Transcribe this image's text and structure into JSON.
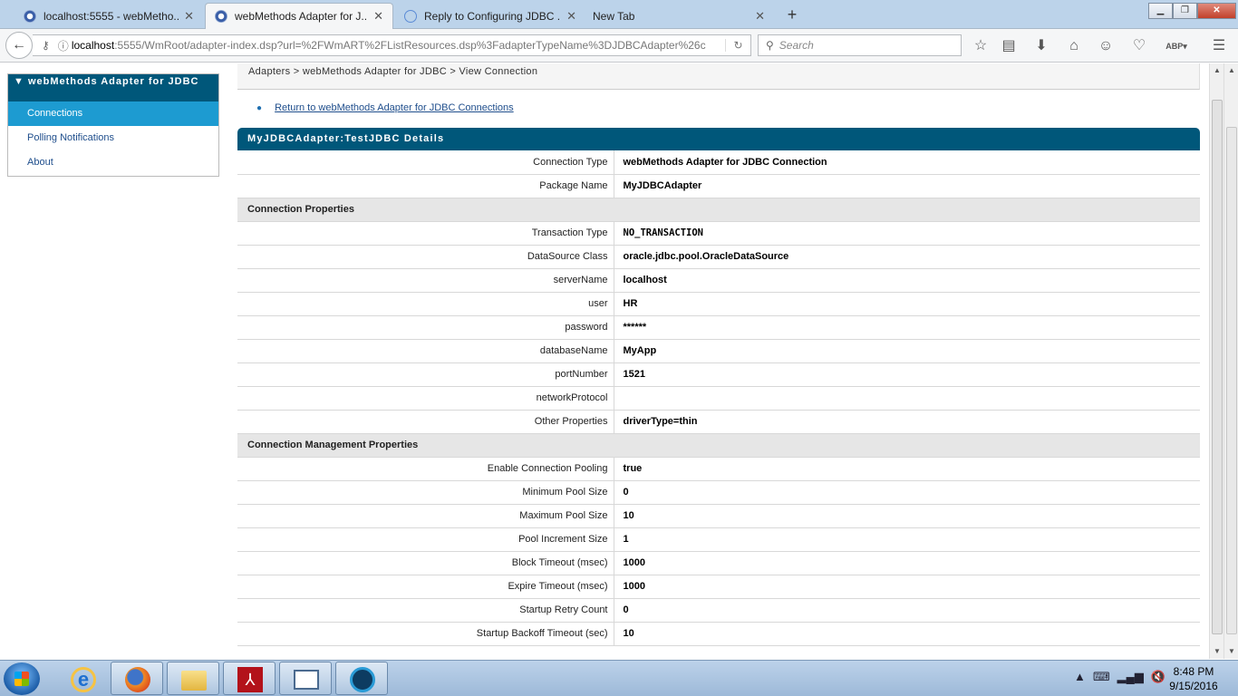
{
  "browser": {
    "tabs": [
      {
        "label": "localhost:5555 - webMetho..."
      },
      {
        "label": "webMethods Adapter for J..."
      },
      {
        "label": "Reply to Configuring JDBC ..."
      },
      {
        "label": "New Tab"
      }
    ],
    "url_host": "localhost",
    "url_rest": ":5555/WmRoot/adapter-index.dsp?url=%2FWmART%2FListResources.dsp%3FadapterTypeName%3DJDBCAdapter%26c",
    "search_placeholder": "Search",
    "abp_label": "ABP"
  },
  "sidebar": {
    "title": "webMethods Adapter for JDBC",
    "items": [
      {
        "label": "Connections"
      },
      {
        "label": "Polling Notifications"
      },
      {
        "label": "About"
      }
    ]
  },
  "breadcrumb": "Adapters > webMethods Adapter for JDBC > View Connection",
  "return_link": "Return to webMethods Adapter for JDBC Connections",
  "details": {
    "title": "MyJDBCAdapter:TestJDBC Details",
    "rows": [
      {
        "label": "Connection Type",
        "value": "webMethods Adapter for JDBC Connection"
      },
      {
        "label": "Package Name",
        "value": "MyJDBCAdapter"
      }
    ],
    "section1": "Connection Properties",
    "conn_props": [
      {
        "label": "Transaction Type",
        "value": "NO_TRANSACTION"
      },
      {
        "label": "DataSource Class",
        "value": "oracle.jdbc.pool.OracleDataSource"
      },
      {
        "label": "serverName",
        "value": "localhost"
      },
      {
        "label": "user",
        "value": "HR"
      },
      {
        "label": "password",
        "value": "******"
      },
      {
        "label": "databaseName",
        "value": "MyApp"
      },
      {
        "label": "portNumber",
        "value": "1521"
      },
      {
        "label": "networkProtocol",
        "value": ""
      },
      {
        "label": "Other Properties",
        "value": "driverType=thin"
      }
    ],
    "section2": "Connection Management Properties",
    "mgmt_props": [
      {
        "label": "Enable Connection Pooling",
        "value": "true"
      },
      {
        "label": "Minimum Pool Size",
        "value": "0"
      },
      {
        "label": "Maximum Pool Size",
        "value": "10"
      },
      {
        "label": "Pool Increment Size",
        "value": "1"
      },
      {
        "label": "Block Timeout (msec)",
        "value": "1000"
      },
      {
        "label": "Expire Timeout (msec)",
        "value": "1000"
      },
      {
        "label": "Startup Retry Count",
        "value": "0"
      },
      {
        "label": "Startup Backoff Timeout (sec)",
        "value": "10"
      }
    ]
  },
  "taskbar": {
    "time": "8:48 PM",
    "date": "9/15/2016"
  },
  "colors": {
    "header_blue": "#00577a",
    "active_item": "#1d9bd1",
    "link": "#1f4e8c"
  }
}
